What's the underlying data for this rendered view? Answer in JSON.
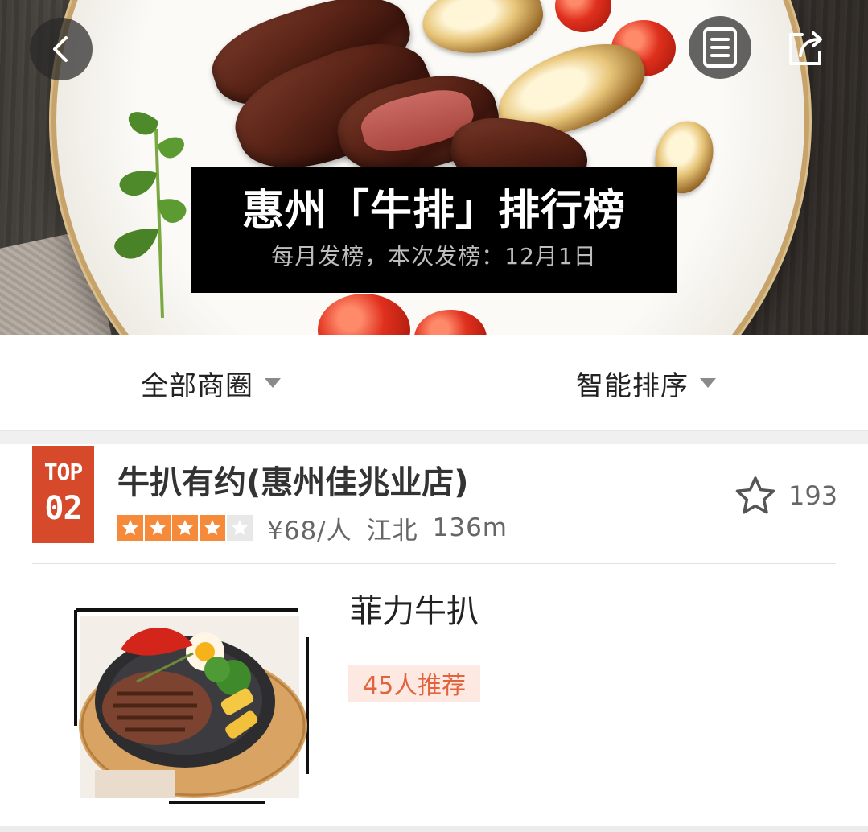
{
  "header": {
    "back_icon": "chevron-left-icon",
    "list_icon": "document-list-icon",
    "share_icon": "share-icon",
    "title": "惠州「牛排」排行榜",
    "subtitle": "每月发榜，本次发榜：12月1日"
  },
  "filters": {
    "area_label": "全部商圈",
    "sort_label": "智能排序"
  },
  "listing": {
    "rank_badge_top": "TOP",
    "rank_badge_num": "02",
    "shop_name": "牛扒有约(惠州佳兆业店)",
    "rating": 4,
    "rating_max": 5,
    "price": "¥68/人",
    "district": "江北",
    "distance": "136m",
    "favorite_count": "193",
    "dish": {
      "name": "菲力牛扒",
      "recommend_tag": "45人推荐"
    }
  },
  "colors": {
    "badge_red": "#d6492a",
    "star_orange": "#f58a3b",
    "tag_bg": "#fde9e2",
    "tag_text": "#e2643c"
  }
}
